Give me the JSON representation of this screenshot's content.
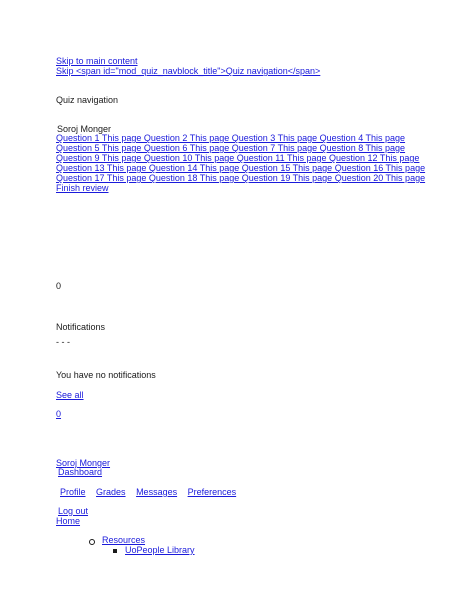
{
  "skip_links": {
    "main": "Skip to main content",
    "nav": "Skip <span id=\"mod_quiz_navblock_title\">Quiz navigation</span>"
  },
  "quiz_nav": {
    "title": "Quiz navigation",
    "user_name": "Soroj Monger",
    "rows": [
      "Question 1 This page Question 2 This page Question 3 This page Question 4 This page",
      "Question 5 This page Question 6 This page Question 7 This page Question 8 This page",
      "Question 9 This page Question 10 This page Question 11 This page Question 12 This page",
      "Question 13 This page Question 14 This page Question 15 This page Question 16 This page",
      "Question 17 This page Question 18 This page Question 19 This page Question 20 This page"
    ],
    "finish_review": "Finish review"
  },
  "notifications": {
    "count_plain": "0",
    "title": "Notifications",
    "dashes": "- - -",
    "empty_message": "You have no notifications",
    "see_all": "See all",
    "count_link": "0"
  },
  "user_menu": {
    "name": "Soroj Monger",
    "dashboard": "Dashboard",
    "items": [
      "Profile",
      "Grades",
      "Messages",
      "Preferences"
    ],
    "logout": "Log out"
  },
  "nav_tree": {
    "home": "Home",
    "resources": "Resources",
    "library": "UoPeople Library"
  }
}
